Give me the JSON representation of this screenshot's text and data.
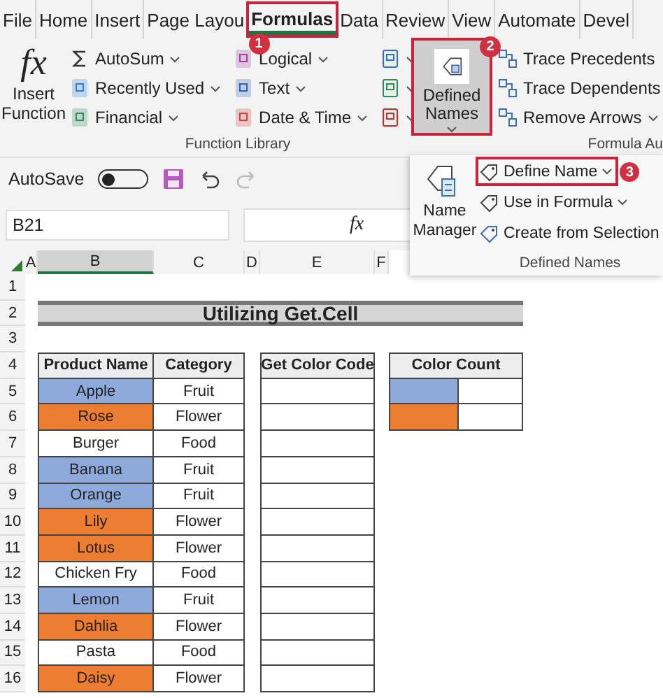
{
  "tabs": [
    {
      "label": "File",
      "selected": false
    },
    {
      "label": "Home",
      "selected": false
    },
    {
      "label": "Insert",
      "selected": false
    },
    {
      "label": "Page Layou",
      "selected": false
    },
    {
      "label": "Formulas",
      "selected": true,
      "callout": "1"
    },
    {
      "label": "Data",
      "selected": false
    },
    {
      "label": "Review",
      "selected": false
    },
    {
      "label": "View",
      "selected": false
    },
    {
      "label": "Automate",
      "selected": false
    },
    {
      "label": "Devel",
      "selected": false
    }
  ],
  "ribbon": {
    "insert_function": {
      "icon_text": "fx",
      "label": "Insert Function"
    },
    "function_library": {
      "columns": [
        [
          {
            "label": "AutoSum",
            "dropdown": true
          },
          {
            "label": "Recently Used",
            "dropdown": true
          },
          {
            "label": "Financial",
            "dropdown": true
          }
        ],
        [
          {
            "label": "Logical",
            "dropdown": true
          },
          {
            "label": "Text",
            "dropdown": true
          },
          {
            "label": "Date & Time",
            "dropdown": true
          }
        ]
      ],
      "group_label": "Function Library"
    },
    "defined_names_button": {
      "label": "Defined Names",
      "pressed": true,
      "callout": "2"
    },
    "formula_auditing": {
      "items": [
        {
          "label": "Trace Precedents",
          "dropdown": false
        },
        {
          "label": "Trace Dependents",
          "dropdown": false
        },
        {
          "label": "Remove Arrows",
          "dropdown": true
        }
      ],
      "group_label": "Formula Au"
    }
  },
  "quick_access": {
    "autosave_label": "AutoSave",
    "autosave_on": false
  },
  "formula_bar": {
    "name_box": "B21",
    "fx_label": "fx"
  },
  "defined_names_menu": {
    "name_manager": "Name Manager",
    "items": [
      {
        "label": "Define Name",
        "dropdown": true,
        "callout": "3"
      },
      {
        "label": "Use in Formula",
        "dropdown": true
      },
      {
        "label": "Create from Selection",
        "dropdown": false
      }
    ],
    "group_label": "Defined Names"
  },
  "sheet": {
    "columns": [
      {
        "label": "A",
        "selected": false
      },
      {
        "label": "B",
        "selected": true
      },
      {
        "label": "C",
        "selected": false
      },
      {
        "label": "D",
        "selected": false
      },
      {
        "label": "E",
        "selected": false
      },
      {
        "label": "F",
        "selected": false
      }
    ],
    "row_numbers": [
      "1",
      "2",
      "3",
      "4",
      "5",
      "6",
      "7",
      "8",
      "9",
      "10",
      "11",
      "12",
      "13",
      "14",
      "15",
      "16"
    ],
    "title": "Utilizing Get.Cell",
    "product_table": {
      "columns": [
        "Product Name",
        "Category"
      ],
      "rows": [
        {
          "name": "Apple",
          "category": "Fruit",
          "color": "#8eaadb"
        },
        {
          "name": "Rose",
          "category": "Flower",
          "color": "#ed7d31"
        },
        {
          "name": "Burger",
          "category": "Food",
          "color": "#ffffff"
        },
        {
          "name": "Banana",
          "category": "Fruit",
          "color": "#8eaadb"
        },
        {
          "name": "Orange",
          "category": "Fruit",
          "color": "#8eaadb"
        },
        {
          "name": "Lily",
          "category": "Flower",
          "color": "#ed7d31"
        },
        {
          "name": "Lotus",
          "category": "Flower",
          "color": "#ed7d31"
        },
        {
          "name": "Chicken Fry",
          "category": "Food",
          "color": "#ffffff"
        },
        {
          "name": "Lemon",
          "category": "Fruit",
          "color": "#8eaadb"
        },
        {
          "name": "Dahlia",
          "category": "Flower",
          "color": "#ed7d31"
        },
        {
          "name": "Pasta",
          "category": "Food",
          "color": "#ffffff"
        },
        {
          "name": "Daisy",
          "category": "Flower",
          "color": "#ed7d31"
        }
      ]
    },
    "color_code_table": {
      "header": "Get Color Code"
    },
    "color_count_table": {
      "header": "Color Count",
      "rows": [
        {
          "color": "#8eaadb"
        },
        {
          "color": "#ed7d31"
        }
      ]
    }
  }
}
